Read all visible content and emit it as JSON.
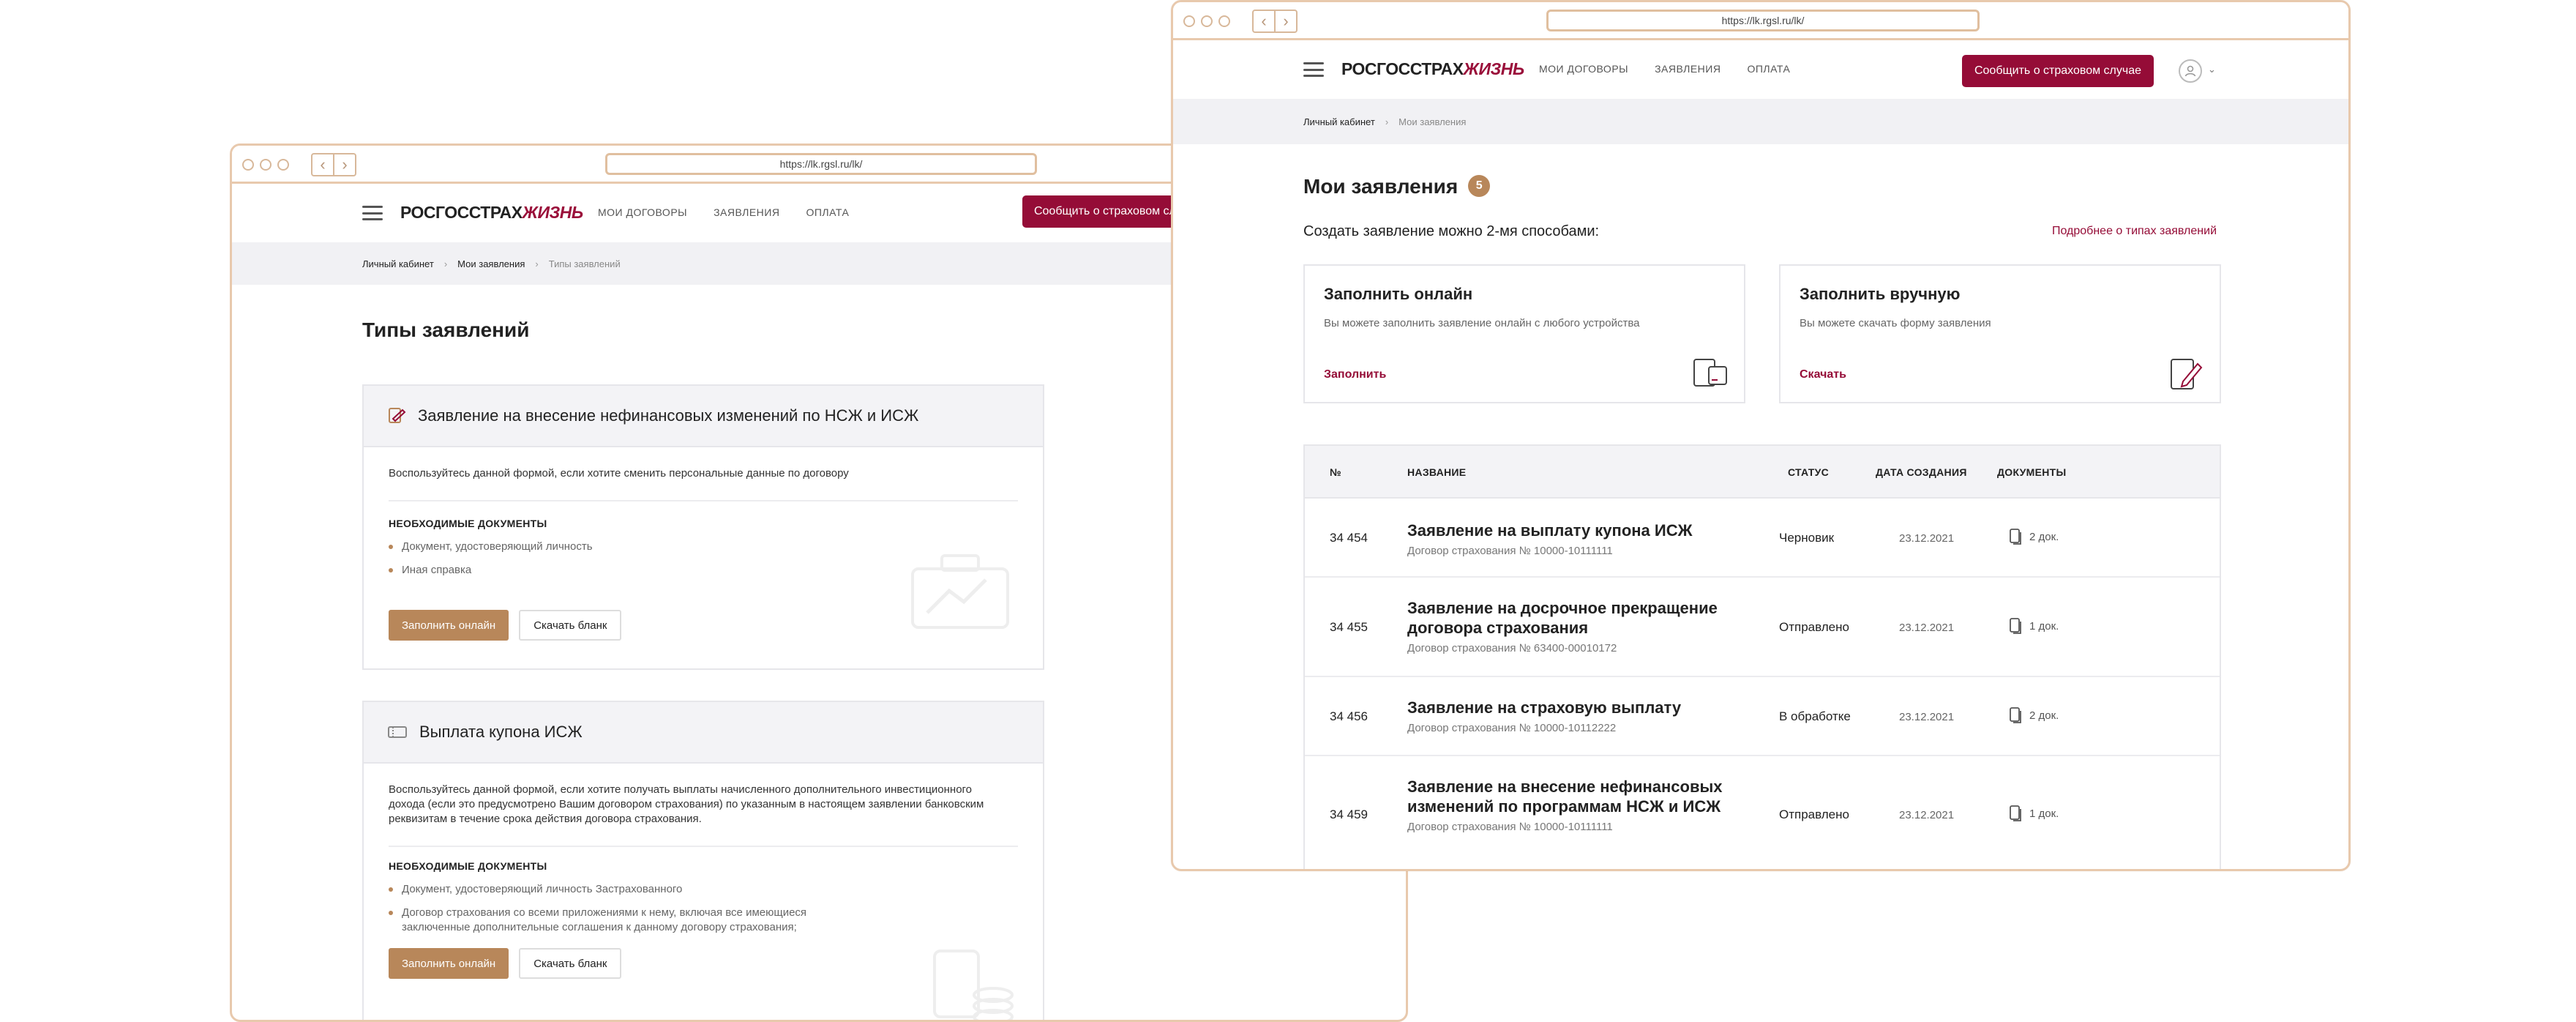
{
  "colors": {
    "accent": "#950c37",
    "tan": "#b8875a",
    "frame": "#e8c9ad"
  },
  "left_window": {
    "url": "https://lk.rgsl.ru/lk/",
    "logo": {
      "part1": "РОСГОССТРАХ",
      "part2": "ЖИЗНЬ"
    },
    "nav": [
      "МОИ ДОГОВОРЫ",
      "ЗАЯВЛЕНИЯ",
      "ОПЛАТА"
    ],
    "cta": "Сообщить о страховом случае",
    "breadcrumbs": [
      "Личный кабинет",
      "Мои заявления",
      "Типы заявлений"
    ],
    "title": "Типы заявлений",
    "cards": [
      {
        "icon": "edit-document-icon",
        "title": "Заявление на внесение нефинансовых изменений по НСЖ и ИСЖ",
        "description": "Воспользуйтесь данной формой, если хотите сменить персональные данные по договору",
        "docs_title": "НЕОБХОДИМЫЕ ДОКУМЕНТЫ",
        "docs": [
          "Документ, удостоверяющий личность",
          "Иная справка"
        ],
        "fill_label": "Заполнить онлайн",
        "download_label": "Скачать бланк"
      },
      {
        "icon": "ticket-icon",
        "title": "Выплата купона ИСЖ",
        "description": "Воспользуйтесь данной формой, если хотите получать выплаты начисленного дополнительного инвестиционного дохода (если это предусмотрено Вашим договором страхования) по указанным в настоящем заявлении банковским реквизитам в течение срока действия договора страхования.",
        "docs_title": "НЕОБХОДИМЫЕ ДОКУМЕНТЫ",
        "docs": [
          "Документ, удостоверяющий личность Застрахованного",
          "Договор страхования со всеми приложениями к нему, включая все имеющиеся заключенные дополнительные соглашения к данному договору страхования;"
        ],
        "fill_label": "Заполнить онлайн",
        "download_label": "Скачать бланк"
      }
    ]
  },
  "right_window": {
    "url": "https://lk.rgsl.ru/lk/",
    "logo": {
      "part1": "РОСГОССТРАХ",
      "part2": "ЖИЗНЬ"
    },
    "nav": [
      "МОИ ДОГОВОРЫ",
      "ЗАЯВЛЕНИЯ",
      "ОПЛАТА"
    ],
    "cta": "Сообщить о страховом случае",
    "breadcrumbs": [
      "Личный кабинет",
      "Мои заявления"
    ],
    "title": "Мои заявления",
    "count": "5",
    "subtitle": "Создать заявление можно 2-мя способами:",
    "more_link": "Подробнее о типах заявлений",
    "methods": [
      {
        "title": "Заполнить онлайн",
        "description": "Вы можете заполнить заявление онлайн с любого устройства",
        "action": "Заполнить",
        "icon": "devices-icon"
      },
      {
        "title": "Заполнить вручную",
        "description": "Вы можете скачать форму заявления",
        "action": "Скачать",
        "icon": "pen-document-icon"
      }
    ],
    "table": {
      "headers": [
        "№",
        "НАЗВАНИЕ",
        "СТАТУС",
        "ДАТА СОЗДАНИЯ",
        "ДОКУМЕНТЫ"
      ],
      "rows": [
        {
          "num": "34 454",
          "name": "Заявление на выплату купона ИСЖ",
          "contract": "Договор страхования № 10000-10111111",
          "status": "Черновик",
          "date": "23.12.2021",
          "docs": "2 док."
        },
        {
          "num": "34 455",
          "name": "Заявление на досрочное прекращение договора страхования",
          "contract": "Договор страхования № 63400-00010172",
          "status": "Отправлено",
          "date": "23.12.2021",
          "docs": "1 док."
        },
        {
          "num": "34 456",
          "name": "Заявление на страховую выплату",
          "contract": "Договор страхования № 10000-10112222",
          "status": "В обработке",
          "date": "23.12.2021",
          "docs": "2 док."
        },
        {
          "num": "34 459",
          "name": "Заявление на внесение нефинансовых изменений по программам НСЖ и ИСЖ",
          "contract": "Договор страхования № 10000-10111111",
          "status": "Отправлено",
          "date": "23.12.2021",
          "docs": "1 док."
        }
      ]
    }
  }
}
